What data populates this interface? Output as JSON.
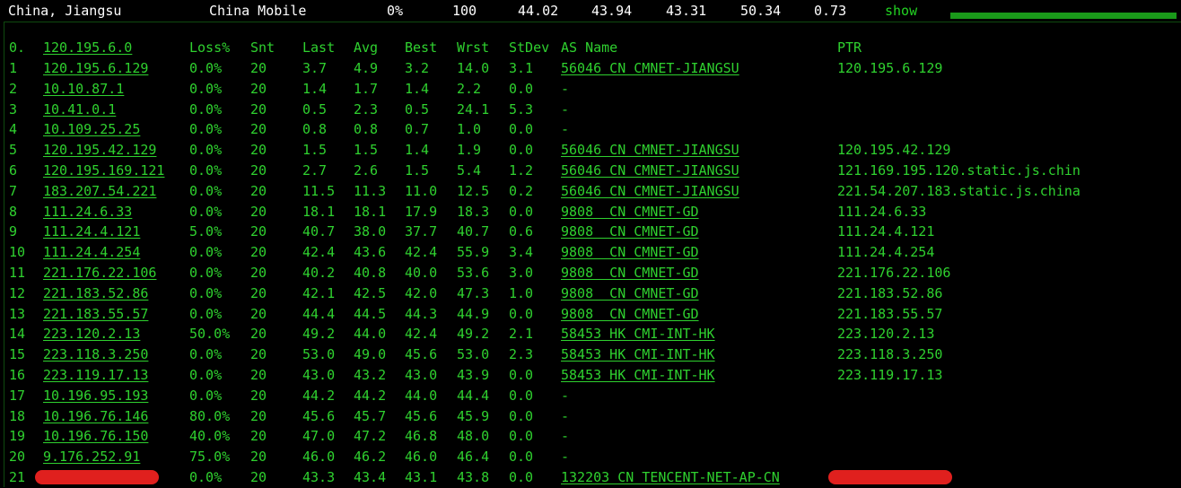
{
  "header": {
    "location": "China, Jiangsu",
    "isp": "China Mobile",
    "loss": "0%",
    "count": "100",
    "v1": "44.02",
    "v2": "43.94",
    "v3": "43.31",
    "v4": "50.34",
    "v5": "0.73",
    "show_label": "show",
    "accent_color": "#22d322",
    "bar_color": "#1a9a1a"
  },
  "table": {
    "columns": {
      "hop": "0.",
      "host": "120.195.6.0",
      "loss": "Loss%",
      "snt": "Snt",
      "last": "Last",
      "avg": "Avg",
      "best": "Best",
      "wrst": "Wrst",
      "stdev": "StDev",
      "asn": "AS Name",
      "ptr": "PTR"
    },
    "rows": [
      {
        "hop": "1",
        "host": "120.195.6.129",
        "loss": "0.0%",
        "snt": "20",
        "last": "3.7",
        "avg": "4.9",
        "best": "3.2",
        "wrst": "14.0",
        "stdev": "3.1",
        "asn": "56046 CN CMNET-JIANGSU",
        "ptr": "120.195.6.129"
      },
      {
        "hop": "2",
        "host": "10.10.87.1",
        "loss": "0.0%",
        "snt": "20",
        "last": "1.4",
        "avg": "1.7",
        "best": "1.4",
        "wrst": "2.2",
        "stdev": "0.0",
        "asn": "-",
        "ptr": ""
      },
      {
        "hop": "3",
        "host": "10.41.0.1",
        "loss": "0.0%",
        "snt": "20",
        "last": "0.5",
        "avg": "2.3",
        "best": "0.5",
        "wrst": "24.1",
        "stdev": "5.3",
        "asn": "-",
        "ptr": ""
      },
      {
        "hop": "4",
        "host": "10.109.25.25",
        "loss": "0.0%",
        "snt": "20",
        "last": "0.8",
        "avg": "0.8",
        "best": "0.7",
        "wrst": "1.0",
        "stdev": "0.0",
        "asn": "-",
        "ptr": ""
      },
      {
        "hop": "5",
        "host": "120.195.42.129",
        "loss": "0.0%",
        "snt": "20",
        "last": "1.5",
        "avg": "1.5",
        "best": "1.4",
        "wrst": "1.9",
        "stdev": "0.0",
        "asn": "56046 CN CMNET-JIANGSU",
        "ptr": "120.195.42.129"
      },
      {
        "hop": "6",
        "host": "120.195.169.121",
        "loss": "0.0%",
        "snt": "20",
        "last": "2.7",
        "avg": "2.6",
        "best": "1.5",
        "wrst": "5.4",
        "stdev": "1.2",
        "asn": "56046 CN CMNET-JIANGSU",
        "ptr": "121.169.195.120.static.js.chin"
      },
      {
        "hop": "7",
        "host": "183.207.54.221",
        "loss": "0.0%",
        "snt": "20",
        "last": "11.5",
        "avg": "11.3",
        "best": "11.0",
        "wrst": "12.5",
        "stdev": "0.2",
        "asn": "56046 CN CMNET-JIANGSU",
        "ptr": "221.54.207.183.static.js.china"
      },
      {
        "hop": "8",
        "host": "111.24.6.33",
        "loss": "0.0%",
        "snt": "20",
        "last": "18.1",
        "avg": "18.1",
        "best": "17.9",
        "wrst": "18.3",
        "stdev": "0.0",
        "asn": "9808  CN CMNET-GD",
        "ptr": "111.24.6.33"
      },
      {
        "hop": "9",
        "host": "111.24.4.121",
        "loss": "5.0%",
        "snt": "20",
        "last": "40.7",
        "avg": "38.0",
        "best": "37.7",
        "wrst": "40.7",
        "stdev": "0.6",
        "asn": "9808  CN CMNET-GD",
        "ptr": "111.24.4.121"
      },
      {
        "hop": "10",
        "host": "111.24.4.254",
        "loss": "0.0%",
        "snt": "20",
        "last": "42.4",
        "avg": "43.6",
        "best": "42.4",
        "wrst": "55.9",
        "stdev": "3.4",
        "asn": "9808  CN CMNET-GD",
        "ptr": "111.24.4.254"
      },
      {
        "hop": "11",
        "host": "221.176.22.106",
        "loss": "0.0%",
        "snt": "20",
        "last": "40.2",
        "avg": "40.8",
        "best": "40.0",
        "wrst": "53.6",
        "stdev": "3.0",
        "asn": "9808  CN CMNET-GD",
        "ptr": "221.176.22.106"
      },
      {
        "hop": "12",
        "host": "221.183.52.86",
        "loss": "0.0%",
        "snt": "20",
        "last": "42.1",
        "avg": "42.5",
        "best": "42.0",
        "wrst": "47.3",
        "stdev": "1.0",
        "asn": "9808  CN CMNET-GD",
        "ptr": "221.183.52.86"
      },
      {
        "hop": "13",
        "host": "221.183.55.57",
        "loss": "0.0%",
        "snt": "20",
        "last": "44.4",
        "avg": "44.5",
        "best": "44.3",
        "wrst": "44.9",
        "stdev": "0.0",
        "asn": "9808  CN CMNET-GD",
        "ptr": "221.183.55.57"
      },
      {
        "hop": "14",
        "host": "223.120.2.13",
        "loss": "50.0%",
        "snt": "20",
        "last": "49.2",
        "avg": "44.0",
        "best": "42.4",
        "wrst": "49.2",
        "stdev": "2.1",
        "asn": "58453 HK CMI-INT-HK",
        "ptr": "223.120.2.13"
      },
      {
        "hop": "15",
        "host": "223.118.3.250",
        "loss": "0.0%",
        "snt": "20",
        "last": "53.0",
        "avg": "49.0",
        "best": "45.6",
        "wrst": "53.0",
        "stdev": "2.3",
        "asn": "58453 HK CMI-INT-HK",
        "ptr": "223.118.3.250"
      },
      {
        "hop": "16",
        "host": "223.119.17.13",
        "loss": "0.0%",
        "snt": "20",
        "last": "43.0",
        "avg": "43.2",
        "best": "43.0",
        "wrst": "43.9",
        "stdev": "0.0",
        "asn": "58453 HK CMI-INT-HK",
        "ptr": "223.119.17.13"
      },
      {
        "hop": "17",
        "host": "10.196.95.193",
        "loss": "0.0%",
        "snt": "20",
        "last": "44.2",
        "avg": "44.2",
        "best": "44.0",
        "wrst": "44.4",
        "stdev": "0.0",
        "asn": "-",
        "ptr": ""
      },
      {
        "hop": "18",
        "host": "10.196.76.146",
        "loss": "80.0%",
        "snt": "20",
        "last": "45.6",
        "avg": "45.7",
        "best": "45.6",
        "wrst": "45.9",
        "stdev": "0.0",
        "asn": "-",
        "ptr": ""
      },
      {
        "hop": "19",
        "host": "10.196.76.150",
        "loss": "40.0%",
        "snt": "20",
        "last": "47.0",
        "avg": "47.2",
        "best": "46.8",
        "wrst": "48.0",
        "stdev": "0.0",
        "asn": "-",
        "ptr": ""
      },
      {
        "hop": "20",
        "host": "9.176.252.91",
        "loss": "75.0%",
        "snt": "20",
        "last": "46.0",
        "avg": "46.2",
        "best": "46.0",
        "wrst": "46.4",
        "stdev": "0.0",
        "asn": "-",
        "ptr": ""
      },
      {
        "hop": "21",
        "host": "",
        "loss": "0.0%",
        "snt": "20",
        "last": "43.3",
        "avg": "43.4",
        "best": "43.1",
        "wrst": "43.8",
        "stdev": "0.0",
        "asn": "132203 CN TENCENT-NET-AP-CN",
        "ptr": "",
        "redacted": true
      }
    ]
  },
  "colors": {
    "background": "#000000",
    "text": "#2fd12f",
    "redaction": "#e0201e"
  }
}
